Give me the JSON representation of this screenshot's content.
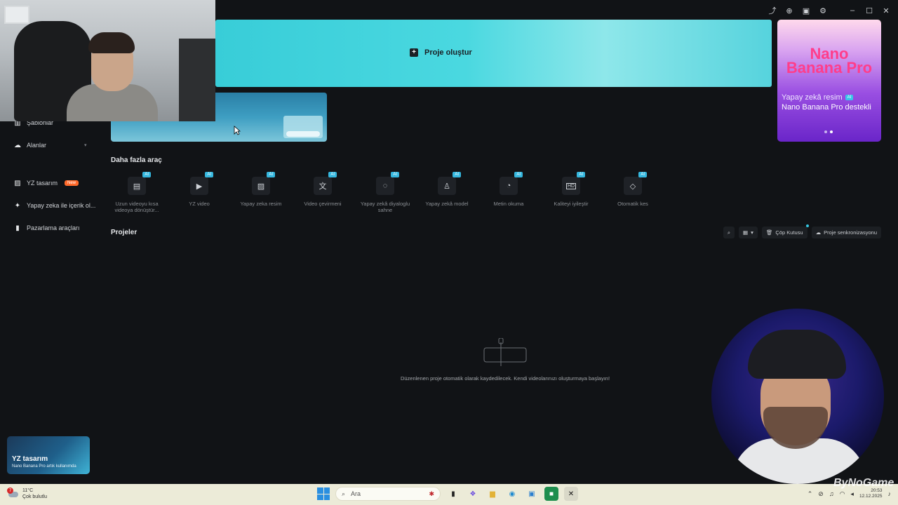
{
  "banner": {
    "cta_label": "Proje oluştur"
  },
  "sidebar": {
    "items": [
      {
        "label": "Şablonlar",
        "icon": "template-icon"
      },
      {
        "label": "Alanlar",
        "icon": "cloud-icon"
      },
      {
        "label": "YZ tasarım",
        "icon": "image-icon",
        "badge": "New"
      },
      {
        "label": "Yapay zeka ile içerik ol...",
        "icon": "sparkle-icon"
      },
      {
        "label": "Pazarlama araçları",
        "icon": "phone-icon"
      }
    ],
    "promo": {
      "title": "YZ tasarım",
      "subtitle": "Nano Banana Pro artık kullanımda"
    }
  },
  "ad": {
    "logo_line1": "Nano",
    "logo_line2": "Banana Pro",
    "line1": "Yapay zekâ resim",
    "ai_badge": "AI",
    "line2": "Nano Banana Pro destekli"
  },
  "tools": {
    "title": "Daha fazla araç",
    "ai_badge": "AI",
    "items": [
      {
        "label": "Uzun videoyu kısa videoya dönüştür...",
        "icon": "film-icon"
      },
      {
        "label": "YZ video",
        "icon": "play-icon"
      },
      {
        "label": "Yapay zeka resim",
        "icon": "image-icon"
      },
      {
        "label": "Video çevirmeni",
        "icon": "translate-icon"
      },
      {
        "label": "Yapay zekâ diyaloglu sahne",
        "icon": "dialog-icon"
      },
      {
        "label": "Yapay zekâ model",
        "icon": "shirt-icon"
      },
      {
        "label": "Metin okuma",
        "icon": "speech-icon"
      },
      {
        "label": "Kaliteyi iyileştir",
        "icon": "hd-icon"
      },
      {
        "label": "Otomatik kes",
        "icon": "eraser-icon"
      }
    ]
  },
  "projects": {
    "title": "Projeler",
    "trash_label": "Çöp Kutusu",
    "sync_label": "Proje senkronizasyonu",
    "empty_text": "Düzenlenen proje otomatik olarak kaydedilecek. Kendi videolarınızı oluşturmaya başlayın!"
  },
  "taskbar": {
    "temp": "11°C",
    "weather": "Çok bulutlu",
    "weather_badge": "7",
    "search_placeholder": "Ara",
    "time": "20:53",
    "date": "12.12.2025"
  },
  "watermark": "ByNoGame"
}
